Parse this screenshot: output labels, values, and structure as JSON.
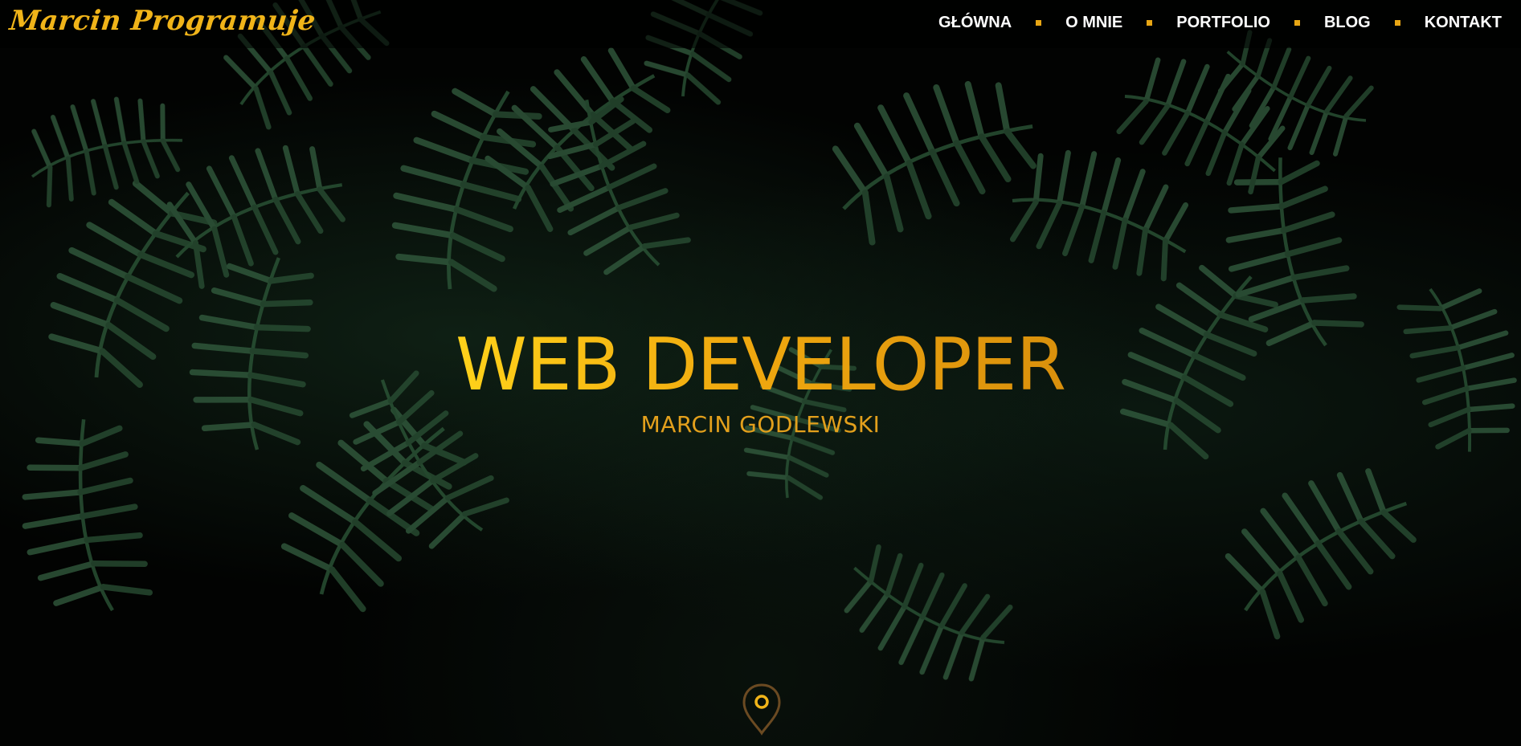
{
  "header": {
    "logo": "Marcin Programuje",
    "nav": [
      {
        "label": "GŁÓWNA"
      },
      {
        "label": "O MNIE"
      },
      {
        "label": "PORTFOLIO"
      },
      {
        "label": "BLOG"
      },
      {
        "label": "KONTAKT"
      }
    ]
  },
  "hero": {
    "title": "WEB DEVELOPER",
    "subtitle": "MARCIN GODLEWSKI"
  },
  "scroll_marker": {
    "icon": "map-pin-icon"
  },
  "colors": {
    "accent": "#f0b419",
    "nav_text": "#ffffff",
    "background": "#020302"
  }
}
